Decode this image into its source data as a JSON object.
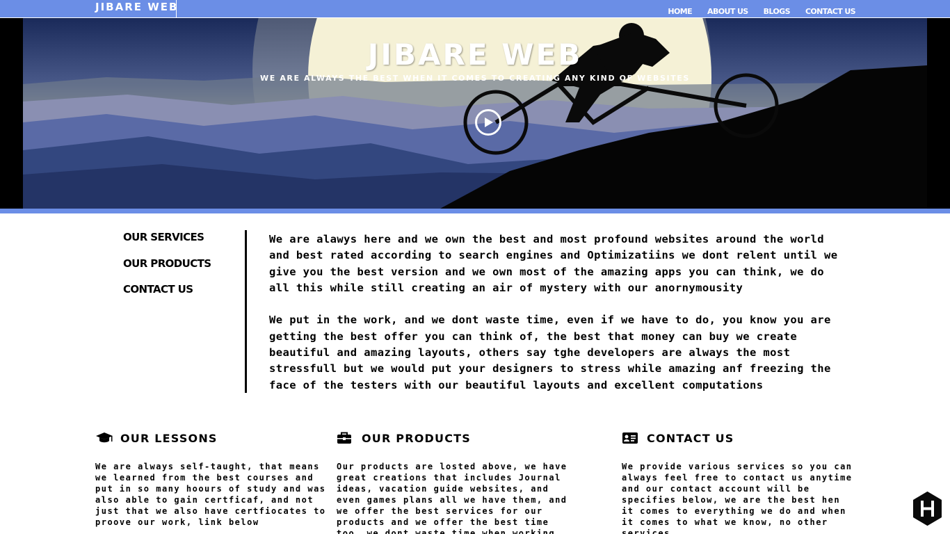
{
  "navbar": {
    "brand": "JIBARE WEB",
    "links": [
      "HOME",
      "ABOUT US",
      "BLOGS",
      "CONTACT US"
    ]
  },
  "hero": {
    "title": "JIBARE WEB",
    "subtitle": "WE ARE ALWAYS THE BEST WHEN IT COMES TO CREATING ANY KIND OF WEBSITES",
    "play_icon": "play-circle-icon"
  },
  "sidebar": {
    "items": [
      "OUR SERVICES",
      "OUR PRODUCTS",
      "CONTACT US"
    ]
  },
  "main": {
    "paragraph1": "We are alawys here and we own the best and most profound websites around the world and best rated according to search engines and Optimizatiins we dont relent until we give you the best version and we own most of the amazing apps you can think, we do all this while still creating an air of mystery with our anornymousity",
    "paragraph2": "We put in the work, and we dont waste time, even if we have to do, you know you are getting the best offer you can think of, the best that money can buy we create beautiful and amazing layouts, others say tghe developers are always the most stressfull but we would put your designers to stress while amazing anf freezing the face of the testers with our beautiful layouts and excellent computations"
  },
  "features": [
    {
      "icon": "graduation-cap-icon",
      "title": "OUR LESSONS",
      "body": "We are always self-taught, that means we learned from the best courses and put in so many hoours of study and was also able to gain certficaf, and not just that we also have certfiocates to proove our work, link below"
    },
    {
      "icon": "toolbox-icon",
      "title": "OUR PRODUCTS",
      "body": "Our products are losted above, we have great creations that includes Journal ideas, vacation guide websites, and even games plans all we have them, and we offer the best services for our products and we offer the best time too, we dont waste time when working"
    },
    {
      "icon": "id-card-icon",
      "title": "CONTACT US",
      "body": "We provide various services so you can always feel free to contact us anytime and our contact account will be specifies below, we are the best hen it comes to everything we do and when it comes to what we know, no other services"
    }
  ],
  "colors": {
    "nav_bg": "#6b8ee6",
    "text": "#000000",
    "background": "#ffffff"
  },
  "floating_badge": "hexagon-h-logo-icon"
}
